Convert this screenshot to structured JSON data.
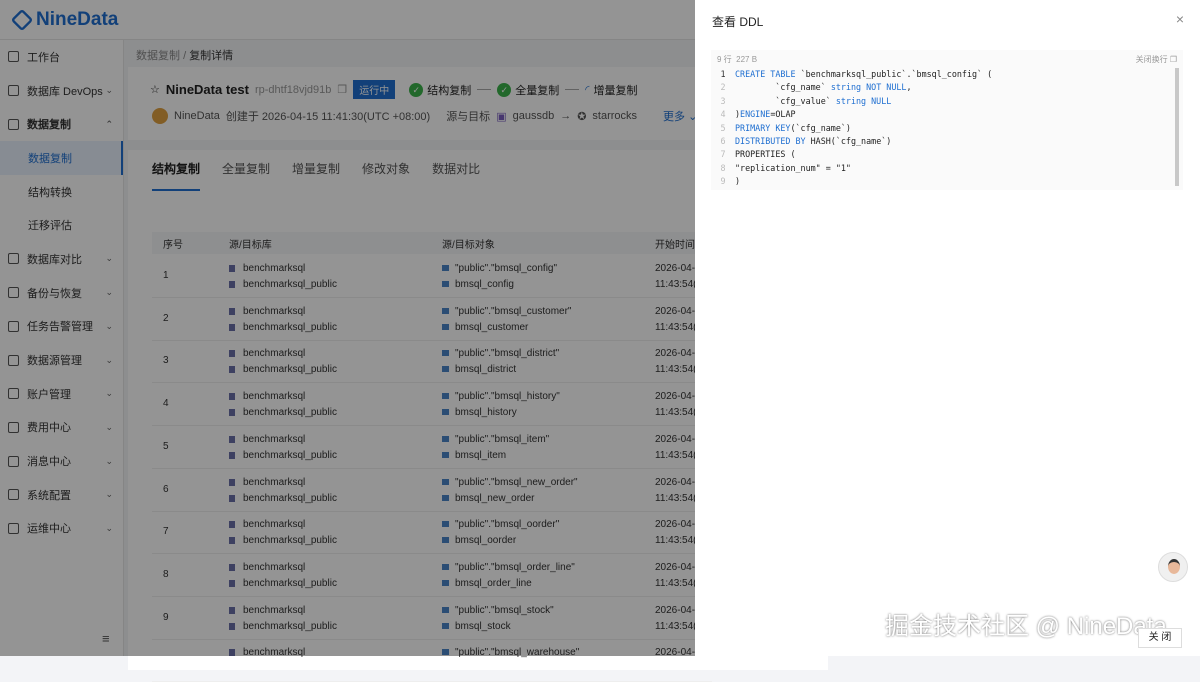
{
  "app": {
    "logo": "NineData"
  },
  "sidebar": {
    "items": [
      {
        "label": "工作台"
      },
      {
        "label": "数据库 DevOps",
        "chev": "⌄"
      },
      {
        "label": "数据复制",
        "chev": "⌃"
      },
      {
        "label": "数据复制",
        "sub": true
      },
      {
        "label": "结构转换",
        "sub": true
      },
      {
        "label": "迁移评估",
        "sub": true
      },
      {
        "label": "数据库对比",
        "chev": "⌄"
      },
      {
        "label": "备份与恢复",
        "chev": "⌄"
      },
      {
        "label": "任务告警管理",
        "chev": "⌄"
      },
      {
        "label": "数据源管理",
        "chev": "⌄"
      },
      {
        "label": "账户管理",
        "chev": "⌄"
      },
      {
        "label": "费用中心",
        "chev": "⌄"
      },
      {
        "label": "消息中心",
        "chev": "⌄"
      },
      {
        "label": "系统配置",
        "chev": "⌄"
      },
      {
        "label": "运维中心",
        "chev": "⌄"
      }
    ],
    "collapse_icon": "≡"
  },
  "breadcrumb": {
    "parent": "数据复制",
    "sep": "/",
    "current": "复制详情"
  },
  "task": {
    "name": "NineData test",
    "id": "rp-dhtf18vjd91b",
    "status": "运行中",
    "steps": [
      "结构复制",
      "全量复制",
      "增量复制"
    ],
    "creator": "NineData",
    "created": "创建于 2026-04-15 11:41:30(UTC +08:00)",
    "src_tgt_label": "源与目标",
    "source": "gaussdb",
    "arrow": "→",
    "target": "starrocks",
    "more": "更多 ⌄"
  },
  "tabs": [
    "结构复制",
    "全量复制",
    "增量复制",
    "修改对象",
    "数据对比"
  ],
  "table": {
    "headers": [
      "序号",
      "源/目标库",
      "源/目标对象",
      "开始时间"
    ],
    "rows": [
      {
        "n": "1",
        "src_db": "benchmarksql",
        "tgt_db": "benchmarksql_public",
        "src_obj": "\"public\".\"bmsql_config\"",
        "tgt_obj": "bmsql_config",
        "t1": "2026-04-",
        "t2": "11:43:54("
      },
      {
        "n": "2",
        "src_db": "benchmarksql",
        "tgt_db": "benchmarksql_public",
        "src_obj": "\"public\".\"bmsql_customer\"",
        "tgt_obj": "bmsql_customer",
        "t1": "2026-04-",
        "t2": "11:43:54("
      },
      {
        "n": "3",
        "src_db": "benchmarksql",
        "tgt_db": "benchmarksql_public",
        "src_obj": "\"public\".\"bmsql_district\"",
        "tgt_obj": "bmsql_district",
        "t1": "2026-04-",
        "t2": "11:43:54("
      },
      {
        "n": "4",
        "src_db": "benchmarksql",
        "tgt_db": "benchmarksql_public",
        "src_obj": "\"public\".\"bmsql_history\"",
        "tgt_obj": "bmsql_history",
        "t1": "2026-04-",
        "t2": "11:43:54("
      },
      {
        "n": "5",
        "src_db": "benchmarksql",
        "tgt_db": "benchmarksql_public",
        "src_obj": "\"public\".\"bmsql_item\"",
        "tgt_obj": "bmsql_item",
        "t1": "2026-04-",
        "t2": "11:43:54("
      },
      {
        "n": "6",
        "src_db": "benchmarksql",
        "tgt_db": "benchmarksql_public",
        "src_obj": "\"public\".\"bmsql_new_order\"",
        "tgt_obj": "bmsql_new_order",
        "t1": "2026-04-",
        "t2": "11:43:54("
      },
      {
        "n": "7",
        "src_db": "benchmarksql",
        "tgt_db": "benchmarksql_public",
        "src_obj": "\"public\".\"bmsql_oorder\"",
        "tgt_obj": "bmsql_oorder",
        "t1": "2026-04-",
        "t2": "11:43:54("
      },
      {
        "n": "8",
        "src_db": "benchmarksql",
        "tgt_db": "benchmarksql_public",
        "src_obj": "\"public\".\"bmsql_order_line\"",
        "tgt_obj": "bmsql_order_line",
        "t1": "2026-04-",
        "t2": "11:43:54("
      },
      {
        "n": "9",
        "src_db": "benchmarksql",
        "tgt_db": "benchmarksql_public",
        "src_obj": "\"public\".\"bmsql_stock\"",
        "tgt_obj": "bmsql_stock",
        "t1": "2026-04-",
        "t2": "11:43:54("
      },
      {
        "n": "",
        "src_db": "benchmarksql",
        "tgt_db": "",
        "src_obj": "\"public\".\"bmsql_warehouse\"",
        "tgt_obj": "",
        "t1": "2026-04-",
        "t2": ""
      }
    ]
  },
  "drawer": {
    "title": "查看 DDL",
    "close_x": "×",
    "lines_info": "9 行",
    "size_info": "227 B",
    "wrap_label": "关闭换行",
    "close_button": "关 闭",
    "code": [
      [
        [
          "kw",
          "CREATE TABLE "
        ],
        [
          "",
          "`benchmarksql_public`.`bmsql_config` ("
        ]
      ],
      [
        [
          "",
          "        `cfg_name` "
        ],
        [
          "kw",
          "string NOT NULL"
        ],
        [
          "",
          ","
        ]
      ],
      [
        [
          "",
          "        `cfg_value` "
        ],
        [
          "kw",
          "string NULL"
        ]
      ],
      [
        [
          "",
          ")"
        ],
        [
          "kw",
          "ENGINE"
        ],
        [
          "",
          "=OLAP"
        ]
      ],
      [
        [
          "kw",
          "PRIMARY KEY"
        ],
        [
          "",
          "(`cfg_name`)"
        ]
      ],
      [
        [
          "kw",
          "DISTRIBUTED BY "
        ],
        [
          "",
          "HASH(`cfg_name`)"
        ]
      ],
      [
        [
          "",
          "PROPERTIES ("
        ]
      ],
      [
        [
          "",
          "\"replication_num\" = \"1\""
        ]
      ],
      [
        [
          "",
          ")"
        ]
      ]
    ]
  },
  "watermark": "掘金技术社区 @ NineData"
}
